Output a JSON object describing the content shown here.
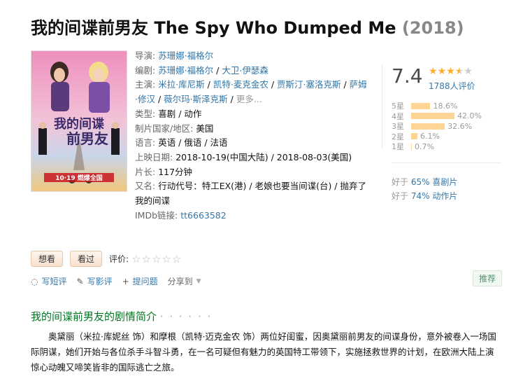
{
  "movie": {
    "title_cn": "我的间谍前男友",
    "title_en": "The Spy Who Dumped Me",
    "year": "(2018)"
  },
  "poster": {
    "title_line1": "我的间谍",
    "title_line2": "前男友",
    "date_text": "10·19 燃爆全国"
  },
  "info": {
    "director_label": "导演:",
    "director": "苏珊娜·福格尔",
    "writer_label": "编剧:",
    "writers": [
      "苏珊娜·福格尔",
      "大卫·伊瑟森"
    ],
    "cast_label": "主演:",
    "cast": [
      "米拉·库尼斯",
      "凯特·麦克金农",
      "贾斯汀·塞洛克斯",
      "萨姆·修汉",
      "薇尔玛·斯泽克斯"
    ],
    "cast_more": "更多...",
    "genre_label": "类型:",
    "genres": [
      "喜剧",
      "动作"
    ],
    "country_label": "制片国家/地区:",
    "country": "美国",
    "language_label": "语言:",
    "languages": "英语 / 俄语 / 法语",
    "release_label": "上映日期:",
    "release": "2018-10-19(中国大陆) / 2018-08-03(美国)",
    "runtime_label": "片长:",
    "runtime": "117分钟",
    "aka_label": "又名:",
    "aka": "行动代号：特工EX(港) / 老娘也要当间谍(台) / 抛弃了我的间谍",
    "imdb_label": "IMDb链接:",
    "imdb": "tt6663582"
  },
  "rating": {
    "score": "7.4",
    "stars_value": 3.5,
    "votes": "1788人评价",
    "bars": [
      {
        "label": "5星",
        "percent": 18.6,
        "text": "18.6%"
      },
      {
        "label": "4星",
        "percent": 42.0,
        "text": "42.0%"
      },
      {
        "label": "3星",
        "percent": 32.6,
        "text": "32.6%"
      },
      {
        "label": "2星",
        "percent": 6.1,
        "text": "6.1%"
      },
      {
        "label": "1星",
        "percent": 0.7,
        "text": "0.7%"
      }
    ],
    "better1_prefix": "好于",
    "better1_value": "65% 喜剧片",
    "better2_prefix": "好于",
    "better2_value": "74% 动作片"
  },
  "actions": {
    "want": "想看",
    "seen": "看过",
    "rate_label": "评价:",
    "write_short": "写短评",
    "write_review": "写影评",
    "ask": "提问题",
    "share": "分享到",
    "recommend": "推荐"
  },
  "synopsis": {
    "title": "我的间谍前男友的剧情简介",
    "dots": "· · · · · ·",
    "text": "奥黛丽（米拉·库妮丝 饰）和摩根（凯特·迈克金农 饰）两位好闺蜜，因奥黛丽前男友的间谍身份，意外被卷入一场国际阴谋，她们开始与各位杀手斗智斗勇，在一名可疑但有魅力的英国特工带领下，实施拯救世界的计划，在欧洲大陆上演惊心动魄又啼笑皆非的国际逃亡之旅。"
  },
  "colors": {
    "link": "#3377aa",
    "green": "#007722",
    "bar": "#ffd596",
    "star": "#ffac2d"
  }
}
